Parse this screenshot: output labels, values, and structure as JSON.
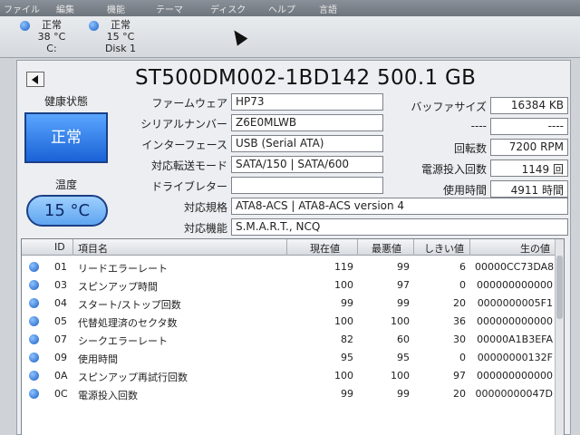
{
  "menubar": [
    "ファイル",
    "編集",
    "機能",
    "テーマ",
    "ディスク",
    "ヘルプ",
    "言語"
  ],
  "disks": [
    {
      "status": "正常",
      "temp": "38 °C",
      "name": "C:"
    },
    {
      "status": "正常",
      "temp": "15 °C",
      "name": "Disk 1"
    }
  ],
  "title": "ST500DM002-1BD142 500.1 GB",
  "health": {
    "label": "健康状態",
    "status": "正常"
  },
  "temperature": {
    "label": "温度",
    "value": "15 °C"
  },
  "info": {
    "firmware": {
      "label": "ファームウェア",
      "value": "HP73"
    },
    "serial": {
      "label": "シリアルナンバー",
      "value": "Z6E0MLWB"
    },
    "interface": {
      "label": "インターフェース",
      "value": "USB (Serial ATA)"
    },
    "transfer": {
      "label": "対応転送モード",
      "value": "SATA/150 | SATA/600"
    },
    "drive_letter": {
      "label": "ドライブレター",
      "value": ""
    },
    "standard": {
      "label": "対応規格",
      "value": "ATA8-ACS | ATA8-ACS version 4"
    },
    "features": {
      "label": "対応機能",
      "value": "S.M.A.R.T., NCQ"
    }
  },
  "right_info": {
    "buffer": {
      "label": "バッファサイズ",
      "value": "16384 KB"
    },
    "blank": {
      "label": "----",
      "value": "----"
    },
    "rotation": {
      "label": "回転数",
      "value": "7200 RPM"
    },
    "power_count": {
      "label": "電源投入回数",
      "value": "1149 回"
    },
    "hours": {
      "label": "使用時間",
      "value": "4911 時間"
    }
  },
  "table": {
    "headers": {
      "id": "ID",
      "name": "項目名",
      "current": "現在値",
      "worst": "最悪値",
      "threshold": "しきい値",
      "raw": "生の値"
    },
    "rows": [
      {
        "id": "01",
        "name": "リードエラーレート",
        "current": "119",
        "worst": "99",
        "threshold": "6",
        "raw": "00000CC73DA8"
      },
      {
        "id": "03",
        "name": "スピンアップ時間",
        "current": "100",
        "worst": "97",
        "threshold": "0",
        "raw": "000000000000"
      },
      {
        "id": "04",
        "name": "スタート/ストップ回数",
        "current": "99",
        "worst": "99",
        "threshold": "20",
        "raw": "0000000005F1"
      },
      {
        "id": "05",
        "name": "代替処理済のセクタ数",
        "current": "100",
        "worst": "100",
        "threshold": "36",
        "raw": "000000000000"
      },
      {
        "id": "07",
        "name": "シークエラーレート",
        "current": "82",
        "worst": "60",
        "threshold": "30",
        "raw": "00000A1B3EFA"
      },
      {
        "id": "09",
        "name": "使用時間",
        "current": "95",
        "worst": "95",
        "threshold": "0",
        "raw": "00000000132F"
      },
      {
        "id": "0A",
        "name": "スピンアップ再試行回数",
        "current": "100",
        "worst": "100",
        "threshold": "97",
        "raw": "000000000000"
      },
      {
        "id": "0C",
        "name": "電源投入回数",
        "current": "99",
        "worst": "99",
        "threshold": "20",
        "raw": "00000000047D"
      }
    ]
  }
}
